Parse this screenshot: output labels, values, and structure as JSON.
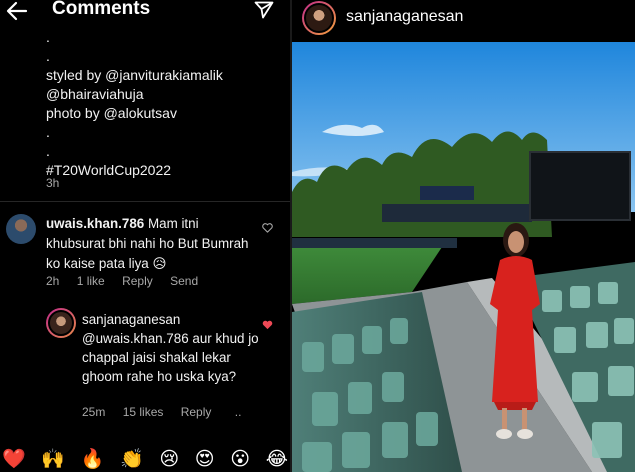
{
  "comments_panel": {
    "title": "Comments",
    "caption_lines": [
      ".",
      ".",
      "styled by @janviturakiamalik",
      "@bhairaviahuja",
      "photo by @alokutsav",
      ".",
      ".",
      "#T20WorldCup2022"
    ],
    "caption_time": "3h",
    "comment1": {
      "username": "uwais.khan.786",
      "text": " Mam itni khubsurat bhi nahi ho But Bumrah ko kaise pata liya ",
      "emoji": "😥",
      "time": "2h",
      "likes": "1 like",
      "reply": "Reply",
      "send": "Send"
    },
    "comment2": {
      "username": "sanjanaganesan",
      "text": "@uwais.khan.786 aur khud jo chappal jaisi shakal lekar ghoom rahe ho uska kya?",
      "time": "25m",
      "likes": "15 likes",
      "reply": "Reply",
      "more": ".."
    },
    "emoji_bar": [
      "❤️",
      "🙌",
      "🔥",
      "👏",
      "😢",
      "😍",
      "😮",
      "😂"
    ]
  },
  "post": {
    "username": "sanjanaganesan"
  },
  "colors": {
    "background": "#000000",
    "secondary_text": "#a8a8a8",
    "like_red": "#ed4956",
    "story_ring_start": "#c02a8a",
    "story_ring_end": "#f5a23c"
  }
}
